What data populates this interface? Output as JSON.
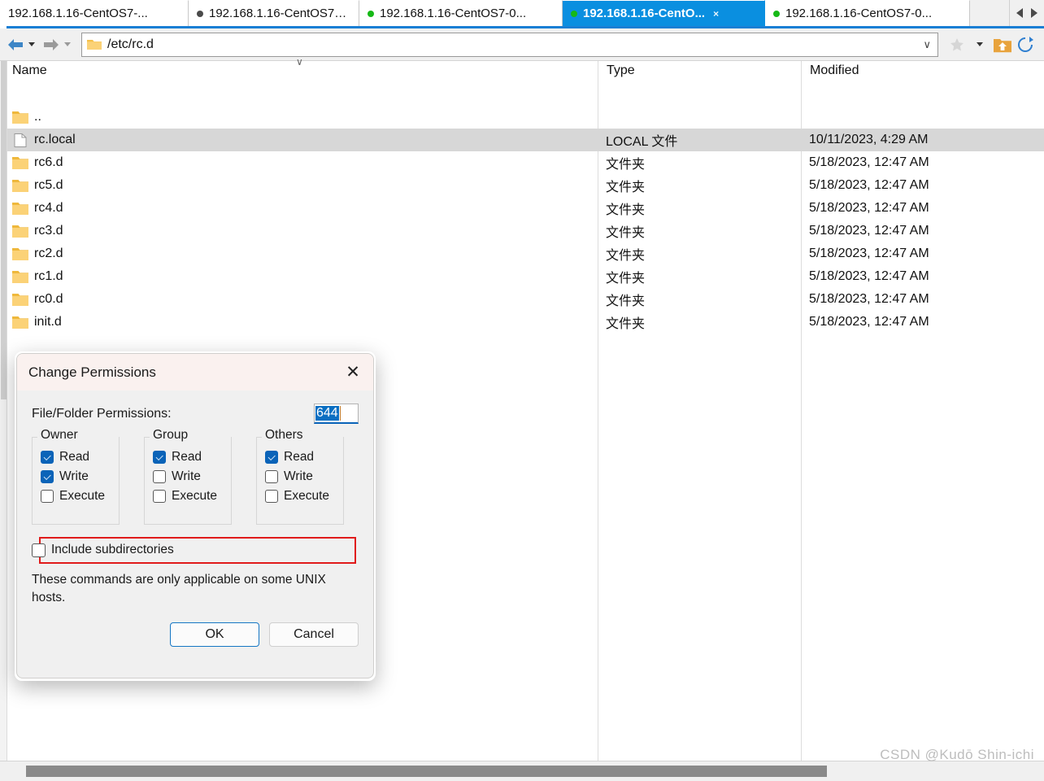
{
  "tabs": {
    "items": [
      {
        "label": "192.168.1.16-CentOS7-...",
        "dot": "none",
        "active": false,
        "closable": false
      },
      {
        "label": "192.168.1.16-CentOS7-0...",
        "dot": "gray",
        "active": false,
        "closable": false
      },
      {
        "label": "192.168.1.16-CentOS7-0...",
        "dot": "green",
        "active": false,
        "closable": false
      },
      {
        "label": "192.168.1.16-CentO...",
        "dot": "green",
        "active": true,
        "closable": true,
        "close_label": "×"
      },
      {
        "label": "192.168.1.16-CentOS7-0...",
        "dot": "green",
        "active": false,
        "closable": false
      }
    ],
    "scroll_left_icon": "triangle-left-icon",
    "scroll_right_icon": "triangle-right-icon"
  },
  "toolbar": {
    "back_icon": "back-arrow-icon",
    "forward_icon": "forward-arrow-icon",
    "path_value": "/etc/rc.d",
    "path_folder_icon": "folder-icon",
    "path_dropdown_glyph": "∨",
    "bookmark_icon": "star-icon",
    "bookmark_dropdown_glyph": "▾",
    "home_icon": "home-folder-icon",
    "refresh_icon": "refresh-icon"
  },
  "filelist": {
    "columns": [
      "Name",
      "Type",
      "Modified"
    ],
    "sort_indicator": "∨",
    "rows": [
      {
        "name": "..",
        "icon": "folder-icon",
        "type": "",
        "modified": "",
        "selected": false
      },
      {
        "name": "rc.local",
        "icon": "file-icon",
        "type": "LOCAL 文件",
        "modified": "10/11/2023, 4:29 AM",
        "selected": true
      },
      {
        "name": "rc6.d",
        "icon": "folder-icon",
        "type": "文件夹",
        "modified": "5/18/2023, 12:47 AM",
        "selected": false
      },
      {
        "name": "rc5.d",
        "icon": "folder-icon",
        "type": "文件夹",
        "modified": "5/18/2023, 12:47 AM",
        "selected": false
      },
      {
        "name": "rc4.d",
        "icon": "folder-icon",
        "type": "文件夹",
        "modified": "5/18/2023, 12:47 AM",
        "selected": false
      },
      {
        "name": "rc3.d",
        "icon": "folder-icon",
        "type": "文件夹",
        "modified": "5/18/2023, 12:47 AM",
        "selected": false
      },
      {
        "name": "rc2.d",
        "icon": "folder-icon",
        "type": "文件夹",
        "modified": "5/18/2023, 12:47 AM",
        "selected": false
      },
      {
        "name": "rc1.d",
        "icon": "folder-icon",
        "type": "文件夹",
        "modified": "5/18/2023, 12:47 AM",
        "selected": false
      },
      {
        "name": "rc0.d",
        "icon": "folder-icon",
        "type": "文件夹",
        "modified": "5/18/2023, 12:47 AM",
        "selected": false
      },
      {
        "name": "init.d",
        "icon": "folder-icon",
        "type": "文件夹",
        "modified": "5/18/2023, 12:47 AM",
        "selected": false
      }
    ]
  },
  "dialog": {
    "title": "Change Permissions",
    "close_glyph": "✕",
    "permissions_label": "File/Folder Permissions:",
    "permissions_value": "644",
    "groups": [
      {
        "legend": "Owner",
        "checks": [
          {
            "label": "Read",
            "checked": true
          },
          {
            "label": "Write",
            "checked": true
          },
          {
            "label": "Execute",
            "checked": false
          }
        ]
      },
      {
        "legend": "Group",
        "checks": [
          {
            "label": "Read",
            "checked": true
          },
          {
            "label": "Write",
            "checked": false
          },
          {
            "label": "Execute",
            "checked": false
          }
        ]
      },
      {
        "legend": "Others",
        "checks": [
          {
            "label": "Read",
            "checked": true
          },
          {
            "label": "Write",
            "checked": false
          },
          {
            "label": "Execute",
            "checked": false
          }
        ]
      }
    ],
    "include_subdirectories": {
      "label": "Include subdirectories",
      "checked": false
    },
    "note": "These commands are only applicable on some UNIX hosts.",
    "ok_label": "OK",
    "cancel_label": "Cancel",
    "annotation_color": "#e01b1b"
  },
  "watermark": "CSDN @Kudō Shin-ichi",
  "colors": {
    "active_tab": "#0a8fe0",
    "accent_blue": "#0a63b8",
    "selection_gray": "#d7d7d7",
    "folder_yellow": "#f5c14b",
    "status_green": "#16b916"
  }
}
